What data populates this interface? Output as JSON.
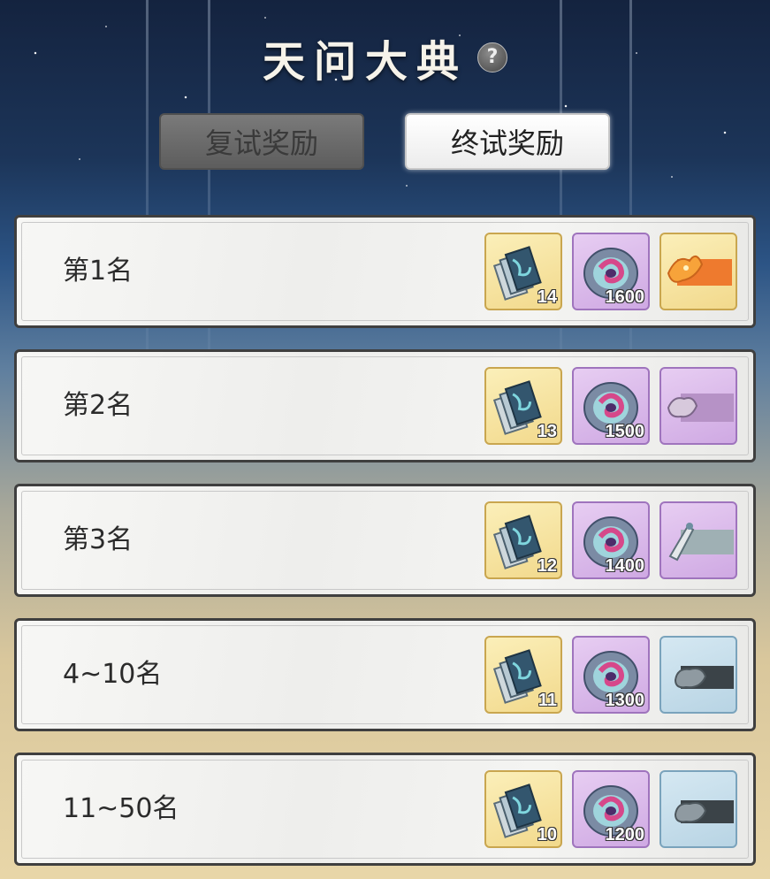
{
  "header": {
    "title": "天问大典",
    "help_icon": "?"
  },
  "tabs": [
    {
      "label": "复试奖励",
      "active": false
    },
    {
      "label": "终试奖励",
      "active": true
    }
  ],
  "rewards": [
    {
      "rank": "第1名",
      "scroll_count": "14",
      "jade_count": "1600",
      "frame": "golden-dragon-frame",
      "frame_rarity": "gold"
    },
    {
      "rank": "第2名",
      "scroll_count": "13",
      "jade_count": "1500",
      "frame": "purple-beast-frame",
      "frame_rarity": "purple"
    },
    {
      "rank": "第3名",
      "scroll_count": "12",
      "jade_count": "1400",
      "frame": "purple-brush-frame",
      "frame_rarity": "purple"
    },
    {
      "rank": "4~10名",
      "scroll_count": "11",
      "jade_count": "1300",
      "frame": "blue-cloud-frame",
      "frame_rarity": "blue"
    },
    {
      "rank": "11~50名",
      "scroll_count": "10",
      "jade_count": "1200",
      "frame": "blue-cloud-frame",
      "frame_rarity": "blue"
    }
  ],
  "colors": {
    "gold_slot": "#f2d98c",
    "purple_slot": "#cfa9e3",
    "blue_slot": "#b8d4e4",
    "row_border": "#3f3f3f"
  }
}
